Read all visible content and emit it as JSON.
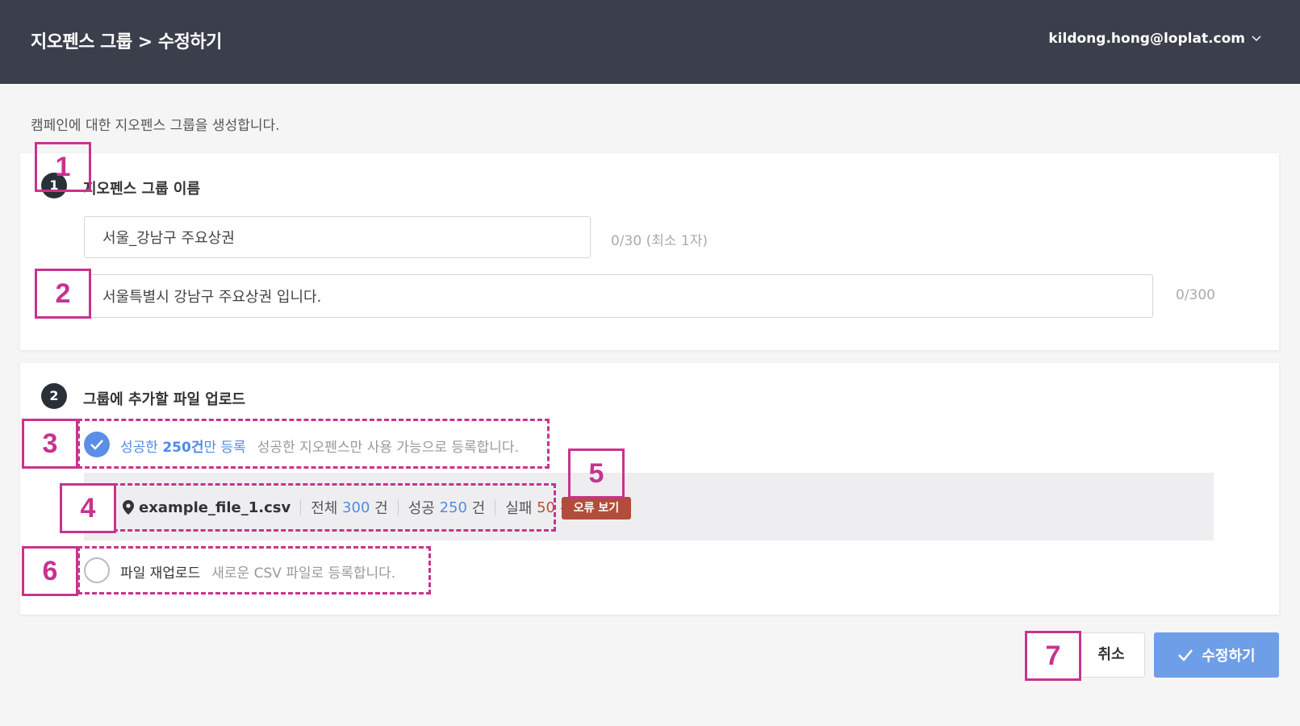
{
  "header": {
    "title": "지오펜스 그룹 > 수정하기",
    "user_email": "kildong.hong@loplat.com"
  },
  "intro_text": "캠페인에 대한 지오펜스 그룹을 생성합니다.",
  "section1": {
    "step": "1",
    "title": "지오펜스 그룹 이름",
    "name_value": "서울_강남구 주요상권",
    "name_counter": "0/30 (최소 1자)",
    "desc_value": "서울특별시 강남구 주요상권 입니다.",
    "desc_counter": "0/300"
  },
  "section2": {
    "step": "2",
    "title": "그룹에 추가할 파일 업로드",
    "option_success": {
      "label_prefix": "성공한 ",
      "label_count": "250건",
      "label_suffix": "만 등록",
      "description": "성공한 지오펜스만 사용 가능으로 등록합니다.",
      "selected": true
    },
    "file": {
      "name": "example_file_1.csv",
      "total_label": "전체",
      "total_value": "300",
      "success_label": "성공",
      "success_value": "250",
      "fail_label": "실패",
      "fail_value": "50",
      "unit": "건",
      "error_button": "오류 보기"
    },
    "option_reupload": {
      "label": "파일 재업로드",
      "description": "새로운 CSV 파일로 등록합니다.",
      "selected": false
    }
  },
  "actions": {
    "cancel_label": "취소",
    "submit_label": "수정하기"
  },
  "annotations": [
    "1",
    "2",
    "3",
    "4",
    "5",
    "6",
    "7"
  ],
  "colors": {
    "header_bg": "#3a3f4b",
    "accent_blue": "#4f8be5",
    "error_red": "#b24d3b",
    "annotation_magenta": "#c8338e"
  }
}
